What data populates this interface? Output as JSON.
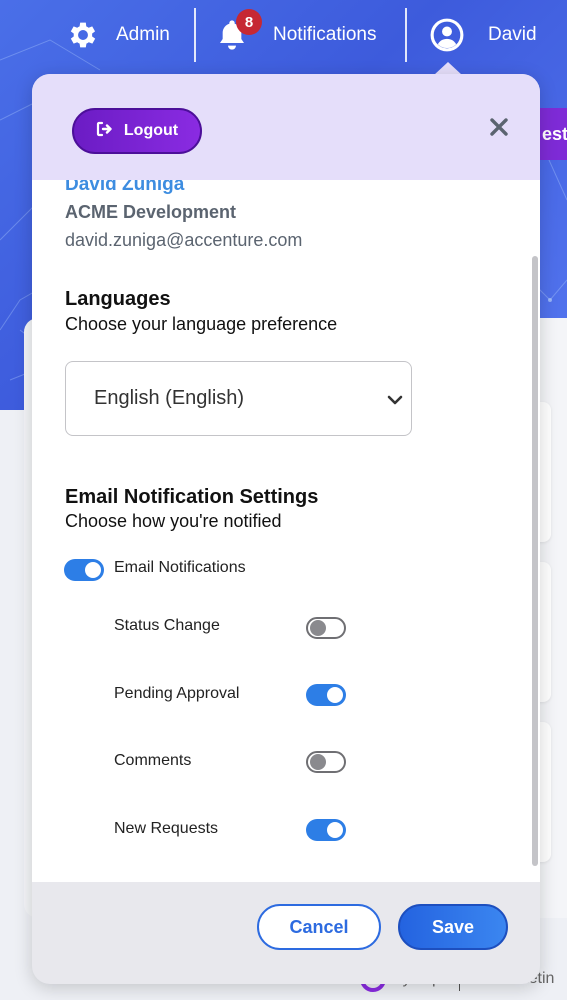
{
  "nav": {
    "admin_label": "Admin",
    "notifications_label": "Notifications",
    "notifications_count": "8",
    "user_label": "David"
  },
  "background": {
    "button_fragment": "est",
    "footer_brand": "SynOps",
    "footer_suffix": "for Marketin"
  },
  "panel": {
    "logout_label": "Logout",
    "user": {
      "name": "David Zuniga",
      "org": "ACME Development",
      "email": "david.zuniga@accenture.com"
    },
    "languages": {
      "title": "Languages",
      "subtitle": "Choose your language preference",
      "selected": "English (English)"
    },
    "email_settings": {
      "title": "Email Notification Settings",
      "subtitle": "Choose how you're notified",
      "master": {
        "label": "Email Notifications",
        "on": true
      },
      "items": [
        {
          "label": "Status Change",
          "on": false
        },
        {
          "label": "Pending Approval",
          "on": true
        },
        {
          "label": "Comments",
          "on": false
        },
        {
          "label": "New Requests",
          "on": true
        }
      ]
    },
    "cancel_label": "Cancel",
    "save_label": "Save"
  },
  "colors": {
    "accent_blue": "#2d7ee6",
    "logout_purple": "#7e2bd6",
    "header_lavender": "#e5defa",
    "name_blue": "#3d8de0"
  }
}
